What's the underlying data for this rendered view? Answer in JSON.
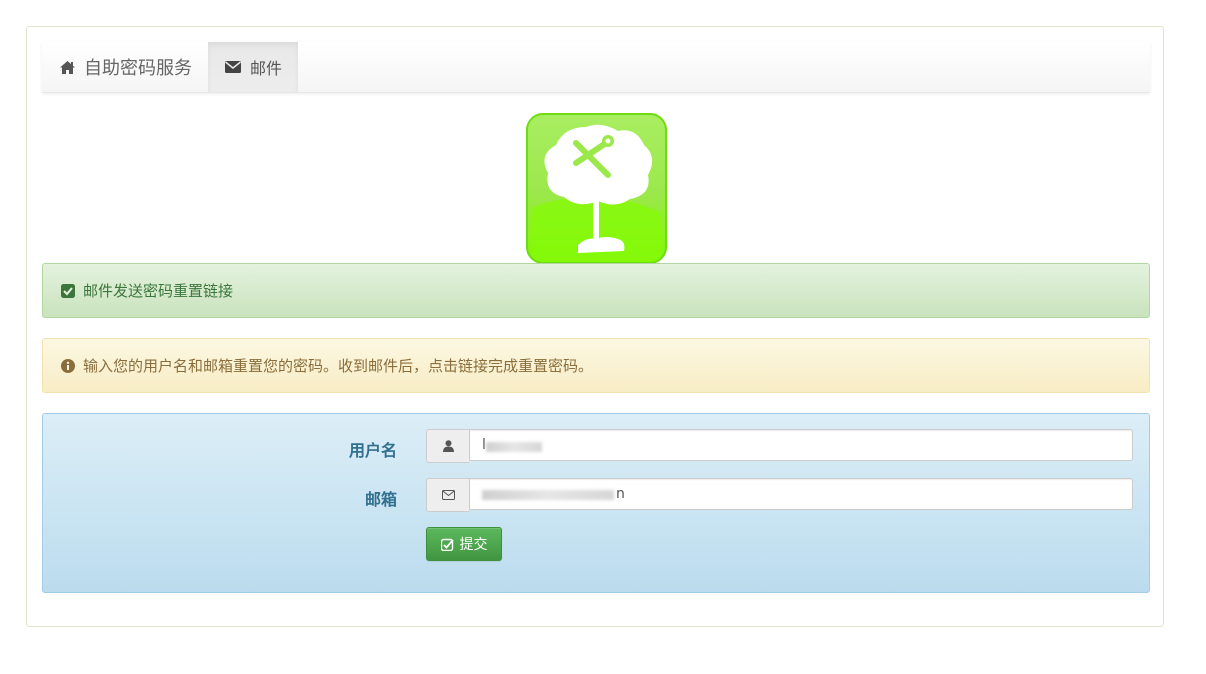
{
  "navbar": {
    "brand_label": "自助密码服务",
    "brand_icon": "home-icon",
    "tabs": [
      {
        "label": "邮件",
        "icon": "envelope-icon",
        "active": true
      }
    ]
  },
  "logo": {
    "icon": "tree-wrench-logo",
    "colors": {
      "top": "#a8f060",
      "bottom": "#7fff00",
      "border": "#66dd00"
    }
  },
  "alerts": {
    "success": {
      "icon": "checkbox-checked-icon",
      "text": "邮件发送密码重置链接"
    },
    "info": {
      "icon": "info-circle-icon",
      "text": "输入您的用户名和邮箱重置您的密码。收到邮件后，点击链接完成重置密码。"
    }
  },
  "form": {
    "username": {
      "label": "用户名",
      "icon": "user-icon",
      "value": "l"
    },
    "email": {
      "label": "邮箱",
      "icon": "envelope-outline-icon",
      "value": "n"
    },
    "submit": {
      "label": "提交",
      "icon": "edit-check-icon"
    }
  },
  "colors": {
    "success_text": "#3c763d",
    "warning_text": "#8a6d3b",
    "label_blue": "#31708f",
    "button_green": "#5cb85c"
  }
}
